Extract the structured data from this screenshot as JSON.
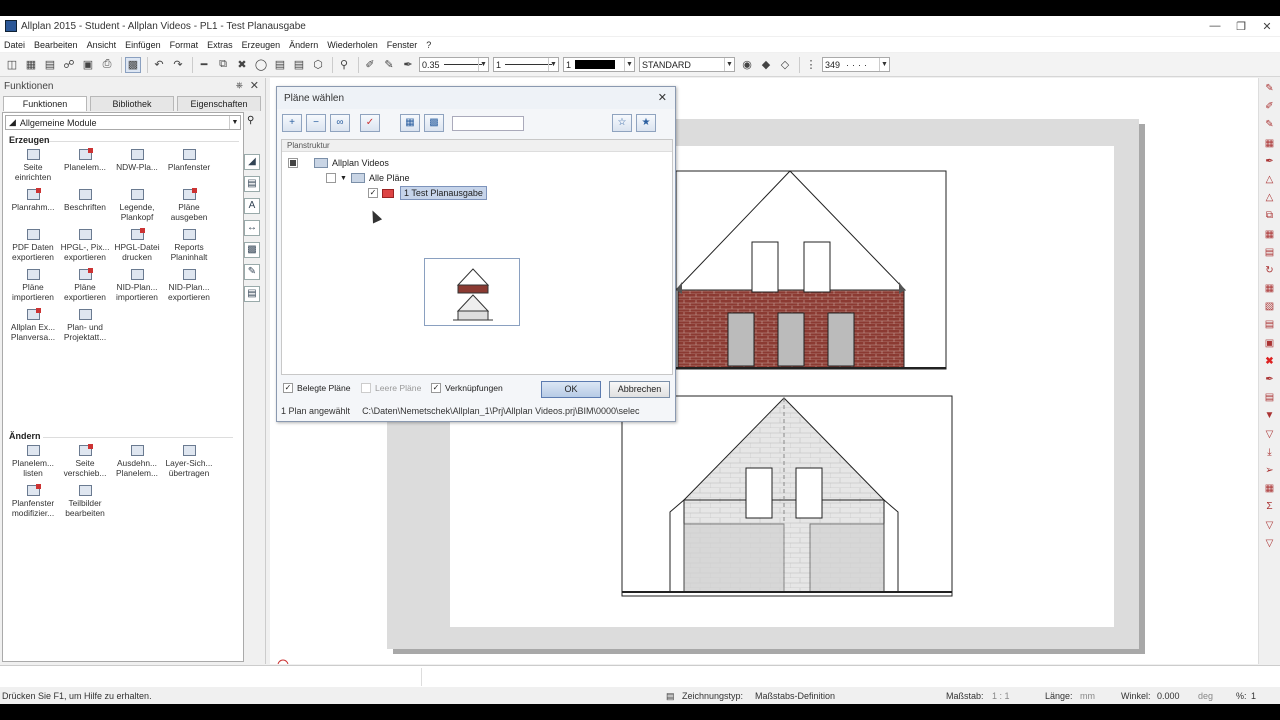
{
  "window": {
    "title": "Allplan 2015 - Student - Allplan Videos - PL1 - Test Planausgabe"
  },
  "menu": [
    "Datei",
    "Bearbeiten",
    "Ansicht",
    "Einfügen",
    "Format",
    "Extras",
    "Erzeugen",
    "Ändern",
    "Wiederholen",
    "Fenster",
    "?"
  ],
  "toolbar": {
    "pen": "0.35",
    "line": "1",
    "color": "1",
    "layer": "STANDARD",
    "number": "349"
  },
  "left_panel": {
    "title": "Funktionen",
    "tabs": [
      "Funktionen",
      "Bibliothek",
      "Eigenschaften"
    ],
    "module": "Allgemeine Module",
    "erzeugen_label": "Erzeugen",
    "erzeugen": [
      {
        "line1": "Seite",
        "line2": "einrichten"
      },
      {
        "line1": "Planelem...",
        "line2": ""
      },
      {
        "line1": "NDW-Pla...",
        "line2": ""
      },
      {
        "line1": "Planfenster",
        "line2": ""
      },
      {
        "line1": "Planrahm...",
        "line2": ""
      },
      {
        "line1": "Beschriften",
        "line2": ""
      },
      {
        "line1": "Legende,",
        "line2": "Plankopf"
      },
      {
        "line1": "Pläne",
        "line2": "ausgeben"
      },
      {
        "line1": "PDF Daten",
        "line2": "exportieren"
      },
      {
        "line1": "HPGL-, Pix...",
        "line2": "exportieren"
      },
      {
        "line1": "HPGL-Datei",
        "line2": "drucken"
      },
      {
        "line1": "Reports",
        "line2": "Planinhalt"
      },
      {
        "line1": "Pläne",
        "line2": "importieren"
      },
      {
        "line1": "Pläne",
        "line2": "exportieren"
      },
      {
        "line1": "NID-Plan...",
        "line2": "importieren"
      },
      {
        "line1": "NID-Plan...",
        "line2": "exportieren"
      },
      {
        "line1": "Allplan Ex...",
        "line2": "Planversa..."
      },
      {
        "line1": "Plan- und",
        "line2": "Projektatt..."
      }
    ],
    "aendern_label": "Ändern",
    "aendern": [
      {
        "line1": "Planelem...",
        "line2": "listen"
      },
      {
        "line1": "Seite",
        "line2": "verschieb..."
      },
      {
        "line1": "Ausdehn...",
        "line2": "Planelem..."
      },
      {
        "line1": "Layer-Sich...",
        "line2": "übertragen"
      },
      {
        "line1": "Planfenster",
        "line2": "modifizier..."
      },
      {
        "line1": "Teilbilder",
        "line2": "bearbeiten"
      }
    ]
  },
  "dialog": {
    "title": "Pläne wählen",
    "column_header": "Planstruktur",
    "tree": {
      "root": "Allplan Videos",
      "group": "Alle Pläne",
      "plan": "1  Test Planausgabe"
    },
    "options": {
      "belegte": "Belegte Pläne",
      "leere": "Leere Pläne",
      "verknuepfungen": "Verknüpfungen"
    },
    "ok": "OK",
    "cancel": "Abbrechen",
    "status": "1 Plan angewählt",
    "path": "C:\\Daten\\Nemetschek\\Allplan_1\\Prj\\Allplan Videos.prj\\BIM\\0000\\selec"
  },
  "statusbar": {
    "help": "Drücken Sie F1, um Hilfe zu erhalten.",
    "drawing_type_label": "Zeichnungstyp:",
    "drawing_type": "Maßstabs-Definition",
    "scale_label": "Maßstab:",
    "scale": "1 : 1",
    "length_label": "Länge:",
    "length_unit": "mm",
    "angle_label": "Winkel:",
    "angle": "0.000",
    "angle_unit": "deg",
    "percent": "%:",
    "percent_value": "1"
  },
  "colors": {
    "brick": "#8b3a32",
    "accent": "#c6d4ea"
  }
}
